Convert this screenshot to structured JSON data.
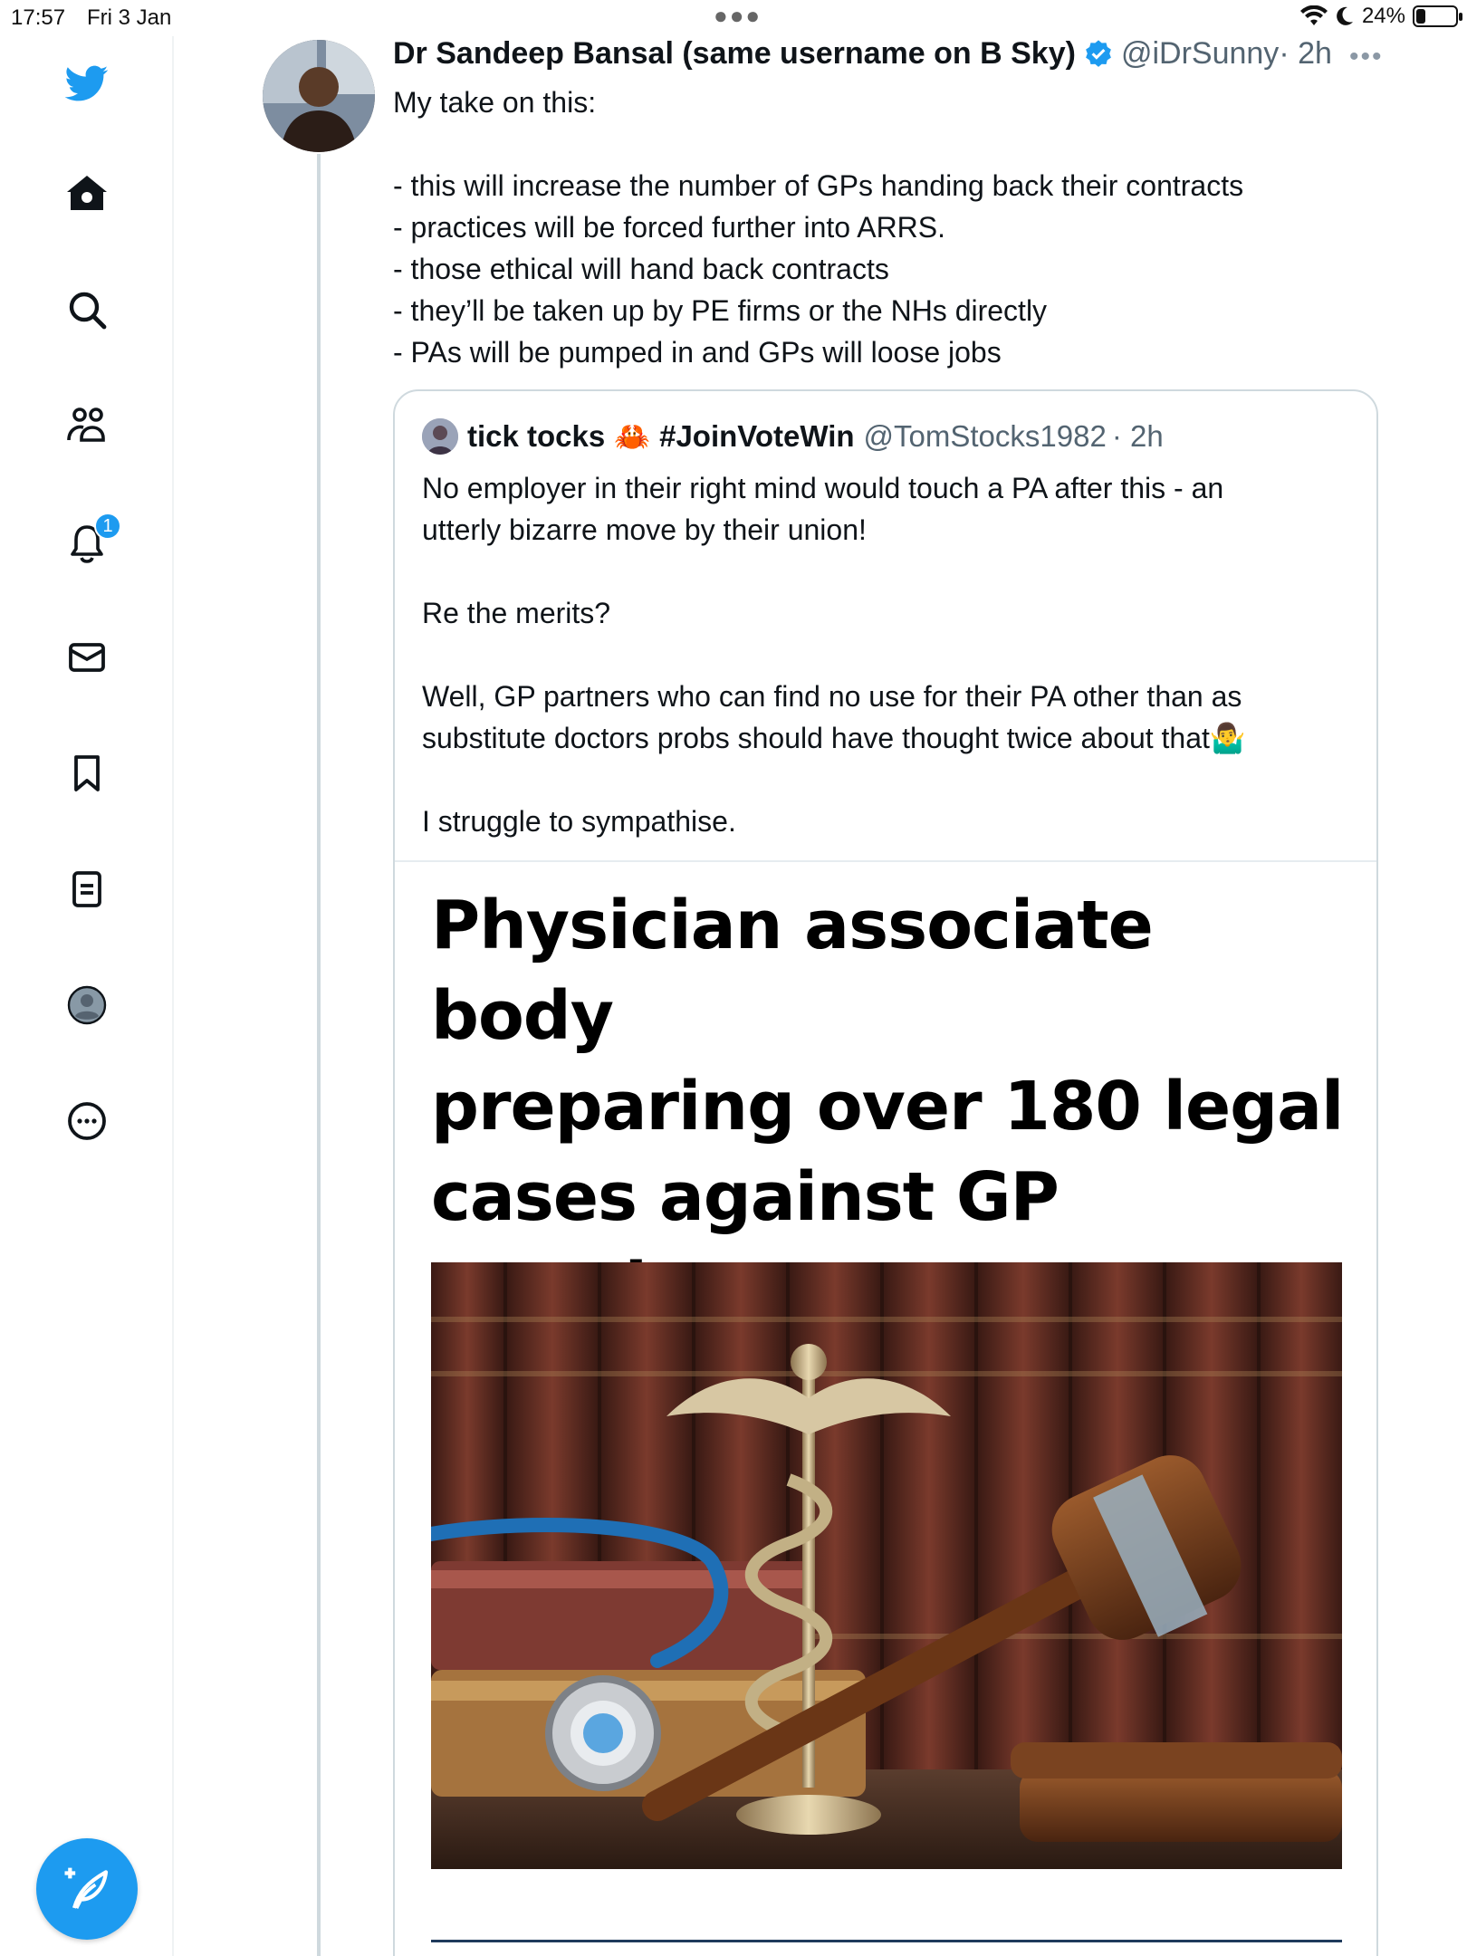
{
  "status_bar": {
    "time": "17:57",
    "date": "Fri 3 Jan",
    "battery": "24%",
    "battery_level": 0.24
  },
  "sidebar": {
    "notification_count": "1"
  },
  "tweet": {
    "author_name": "Dr Sandeep Bansal (same username on B Sky)",
    "handle": "@iDrSunny",
    "time": "· 2h",
    "more": "•••",
    "lines": [
      "My take on this:",
      "",
      "- this will increase the number of GPs handing back their contracts",
      "- practices will be forced further into ARRS.",
      "- those ethical will hand back contracts",
      "- they’ll be taken up by PE firms or the NHs directly",
      "- PAs will be pumped in and GPs will loose jobs"
    ]
  },
  "quoted_tweet": {
    "author_name": "tick tocks",
    "crab_emoji": "🦀",
    "author_suffix": "#JoinVoteWin",
    "handle": "@TomStocks1982",
    "time": "· 2h",
    "lines": [
      "No employer in their right mind would touch a PA after this - an",
      "utterly bizarre move by their union!",
      "",
      "Re the merits?",
      "",
      "Well, GP partners who can find no use for their PA other than as",
      "substitute doctors probs should have thought twice about that🤷‍♂️",
      "",
      "I struggle to sympathise."
    ],
    "headline_lines": [
      "Physician associate body",
      "preparing over 180 legal",
      "cases against GP",
      "practices"
    ]
  },
  "colors": {
    "accent": "#1d9bf0",
    "text": "#0f1419",
    "muted": "#536471",
    "border": "#cfd9de"
  }
}
